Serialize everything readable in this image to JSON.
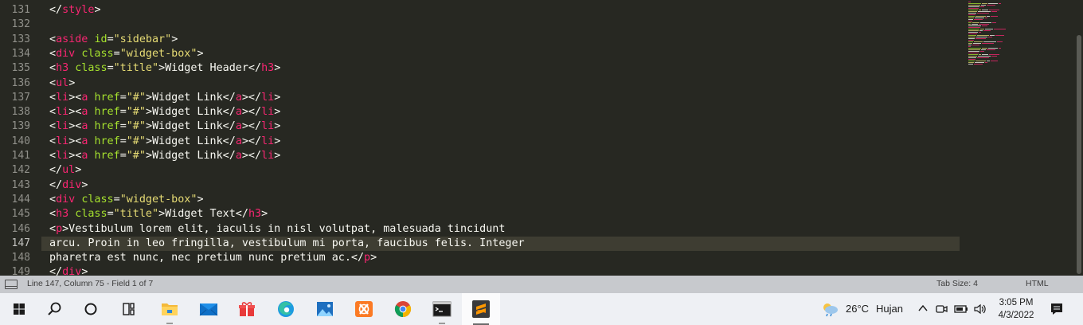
{
  "editor": {
    "lines": [
      {
        "no": "131",
        "tokens": [
          {
            "t": "txt",
            "v": "</"
          },
          {
            "t": "tag",
            "v": "style"
          },
          {
            "t": "txt",
            "v": ">"
          }
        ]
      },
      {
        "no": "132",
        "tokens": []
      },
      {
        "no": "133",
        "tokens": [
          {
            "t": "txt",
            "v": "<"
          },
          {
            "t": "tag",
            "v": "aside"
          },
          {
            "t": "txt",
            "v": " "
          },
          {
            "t": "attr",
            "v": "id"
          },
          {
            "t": "txt",
            "v": "="
          },
          {
            "t": "str",
            "v": "\"sidebar\""
          },
          {
            "t": "txt",
            "v": ">"
          }
        ]
      },
      {
        "no": "134",
        "tokens": [
          {
            "t": "txt",
            "v": "<"
          },
          {
            "t": "tag",
            "v": "div"
          },
          {
            "t": "txt",
            "v": " "
          },
          {
            "t": "attr",
            "v": "class"
          },
          {
            "t": "txt",
            "v": "="
          },
          {
            "t": "str",
            "v": "\"widget-box\""
          },
          {
            "t": "txt",
            "v": ">"
          }
        ]
      },
      {
        "no": "135",
        "tokens": [
          {
            "t": "txt",
            "v": "<"
          },
          {
            "t": "tag",
            "v": "h3"
          },
          {
            "t": "txt",
            "v": " "
          },
          {
            "t": "attr",
            "v": "class"
          },
          {
            "t": "txt",
            "v": "="
          },
          {
            "t": "str",
            "v": "\"title\""
          },
          {
            "t": "txt",
            "v": ">Widget Header</"
          },
          {
            "t": "tag",
            "v": "h3"
          },
          {
            "t": "txt",
            "v": ">"
          }
        ]
      },
      {
        "no": "136",
        "tokens": [
          {
            "t": "txt",
            "v": "<"
          },
          {
            "t": "tag",
            "v": "ul"
          },
          {
            "t": "txt",
            "v": ">"
          }
        ]
      },
      {
        "no": "137",
        "tokens": [
          {
            "t": "txt",
            "v": "<"
          },
          {
            "t": "tag",
            "v": "li"
          },
          {
            "t": "txt",
            "v": "><"
          },
          {
            "t": "tag",
            "v": "a"
          },
          {
            "t": "txt",
            "v": " "
          },
          {
            "t": "attr",
            "v": "href"
          },
          {
            "t": "txt",
            "v": "="
          },
          {
            "t": "str",
            "v": "\"#\""
          },
          {
            "t": "txt",
            "v": ">Widget Link</"
          },
          {
            "t": "tag",
            "v": "a"
          },
          {
            "t": "txt",
            "v": "></"
          },
          {
            "t": "tag",
            "v": "li"
          },
          {
            "t": "txt",
            "v": ">"
          }
        ]
      },
      {
        "no": "138",
        "tokens": [
          {
            "t": "txt",
            "v": "<"
          },
          {
            "t": "tag",
            "v": "li"
          },
          {
            "t": "txt",
            "v": "><"
          },
          {
            "t": "tag",
            "v": "a"
          },
          {
            "t": "txt",
            "v": " "
          },
          {
            "t": "attr",
            "v": "href"
          },
          {
            "t": "txt",
            "v": "="
          },
          {
            "t": "str",
            "v": "\"#\""
          },
          {
            "t": "txt",
            "v": ">Widget Link</"
          },
          {
            "t": "tag",
            "v": "a"
          },
          {
            "t": "txt",
            "v": "></"
          },
          {
            "t": "tag",
            "v": "li"
          },
          {
            "t": "txt",
            "v": ">"
          }
        ]
      },
      {
        "no": "139",
        "tokens": [
          {
            "t": "txt",
            "v": "<"
          },
          {
            "t": "tag",
            "v": "li"
          },
          {
            "t": "txt",
            "v": "><"
          },
          {
            "t": "tag",
            "v": "a"
          },
          {
            "t": "txt",
            "v": " "
          },
          {
            "t": "attr",
            "v": "href"
          },
          {
            "t": "txt",
            "v": "="
          },
          {
            "t": "str",
            "v": "\"#\""
          },
          {
            "t": "txt",
            "v": ">Widget Link</"
          },
          {
            "t": "tag",
            "v": "a"
          },
          {
            "t": "txt",
            "v": "></"
          },
          {
            "t": "tag",
            "v": "li"
          },
          {
            "t": "txt",
            "v": ">"
          }
        ]
      },
      {
        "no": "140",
        "tokens": [
          {
            "t": "txt",
            "v": "<"
          },
          {
            "t": "tag",
            "v": "li"
          },
          {
            "t": "txt",
            "v": "><"
          },
          {
            "t": "tag",
            "v": "a"
          },
          {
            "t": "txt",
            "v": " "
          },
          {
            "t": "attr",
            "v": "href"
          },
          {
            "t": "txt",
            "v": "="
          },
          {
            "t": "str",
            "v": "\"#\""
          },
          {
            "t": "txt",
            "v": ">Widget Link</"
          },
          {
            "t": "tag",
            "v": "a"
          },
          {
            "t": "txt",
            "v": "></"
          },
          {
            "t": "tag",
            "v": "li"
          },
          {
            "t": "txt",
            "v": ">"
          }
        ]
      },
      {
        "no": "141",
        "tokens": [
          {
            "t": "txt",
            "v": "<"
          },
          {
            "t": "tag",
            "v": "li"
          },
          {
            "t": "txt",
            "v": "><"
          },
          {
            "t": "tag",
            "v": "a"
          },
          {
            "t": "txt",
            "v": " "
          },
          {
            "t": "attr",
            "v": "href"
          },
          {
            "t": "txt",
            "v": "="
          },
          {
            "t": "str",
            "v": "\"#\""
          },
          {
            "t": "txt",
            "v": ">Widget Link</"
          },
          {
            "t": "tag",
            "v": "a"
          },
          {
            "t": "txt",
            "v": "></"
          },
          {
            "t": "tag",
            "v": "li"
          },
          {
            "t": "txt",
            "v": ">"
          }
        ]
      },
      {
        "no": "142",
        "tokens": [
          {
            "t": "txt",
            "v": "</"
          },
          {
            "t": "tag",
            "v": "ul"
          },
          {
            "t": "txt",
            "v": ">"
          }
        ]
      },
      {
        "no": "143",
        "tokens": [
          {
            "t": "txt",
            "v": "</"
          },
          {
            "t": "tag",
            "v": "div"
          },
          {
            "t": "txt",
            "v": ">"
          }
        ]
      },
      {
        "no": "144",
        "tokens": [
          {
            "t": "txt",
            "v": "<"
          },
          {
            "t": "tag",
            "v": "div"
          },
          {
            "t": "txt",
            "v": " "
          },
          {
            "t": "attr",
            "v": "class"
          },
          {
            "t": "txt",
            "v": "="
          },
          {
            "t": "str",
            "v": "\"widget-box\""
          },
          {
            "t": "txt",
            "v": ">"
          }
        ]
      },
      {
        "no": "145",
        "tokens": [
          {
            "t": "txt",
            "v": "<"
          },
          {
            "t": "tag",
            "v": "h3"
          },
          {
            "t": "txt",
            "v": " "
          },
          {
            "t": "attr",
            "v": "class"
          },
          {
            "t": "txt",
            "v": "="
          },
          {
            "t": "str",
            "v": "\"title\""
          },
          {
            "t": "txt",
            "v": ">Widget Text</"
          },
          {
            "t": "tag",
            "v": "h3"
          },
          {
            "t": "txt",
            "v": ">"
          }
        ]
      },
      {
        "no": "146",
        "tokens": [
          {
            "t": "txt",
            "v": "<"
          },
          {
            "t": "tag",
            "v": "p"
          },
          {
            "t": "txt",
            "v": ">Vestibulum lorem elit, iaculis in nisl volutpat, malesuada tincidunt"
          }
        ]
      },
      {
        "no": "147",
        "active": true,
        "tokens": [
          {
            "t": "txt",
            "v": "arcu. Proin in leo fringilla, vestibulum mi porta, faucibus felis. Integer"
          }
        ]
      },
      {
        "no": "148",
        "tokens": [
          {
            "t": "txt",
            "v": "pharetra est nunc, nec pretium nunc pretium ac.</"
          },
          {
            "t": "tag",
            "v": "p"
          },
          {
            "t": "txt",
            "v": ">"
          }
        ]
      },
      {
        "no": "149",
        "tokens": [
          {
            "t": "txt",
            "v": "</"
          },
          {
            "t": "tag",
            "v": "div"
          },
          {
            "t": "txt",
            "v": ">"
          }
        ]
      }
    ]
  },
  "statusbar": {
    "position": "Line 147, Column 75 - Field 1 of 7",
    "tab_size": "Tab Size: 4",
    "syntax": "HTML"
  },
  "taskbar": {
    "apps": [
      {
        "name": "start-button",
        "icon": "windows-logo-icon"
      },
      {
        "name": "search-button",
        "icon": "search-icon"
      },
      {
        "name": "cortana-button",
        "icon": "cortana-circle-icon"
      },
      {
        "name": "task-view-button",
        "icon": "task-view-icon"
      },
      {
        "name": "file-explorer-button",
        "icon": "folder-icon"
      },
      {
        "name": "mail-button",
        "icon": "mail-icon"
      },
      {
        "name": "gift-app-button",
        "icon": "gift-icon"
      },
      {
        "name": "edge-button",
        "icon": "edge-icon"
      },
      {
        "name": "photos-button",
        "icon": "photos-icon"
      },
      {
        "name": "xampp-button",
        "icon": "xampp-icon"
      },
      {
        "name": "chrome-button",
        "icon": "chrome-icon"
      },
      {
        "name": "terminal-button",
        "icon": "terminal-icon"
      },
      {
        "name": "sublime-button",
        "icon": "sublime-icon"
      }
    ],
    "weather": {
      "temp": "26°C",
      "condition": "Hujan"
    },
    "clock": {
      "time": "3:05 PM",
      "date": "4/3/2022"
    }
  },
  "colors": {
    "editor_bg": "#272822",
    "tag": "#f92672",
    "attr": "#a6e22e",
    "string": "#e6db74",
    "text": "#f8f8f2",
    "gutter_text": "#90908a",
    "statusbar_bg": "#c7c9cd",
    "taskbar_bg": "#eef0f4"
  }
}
